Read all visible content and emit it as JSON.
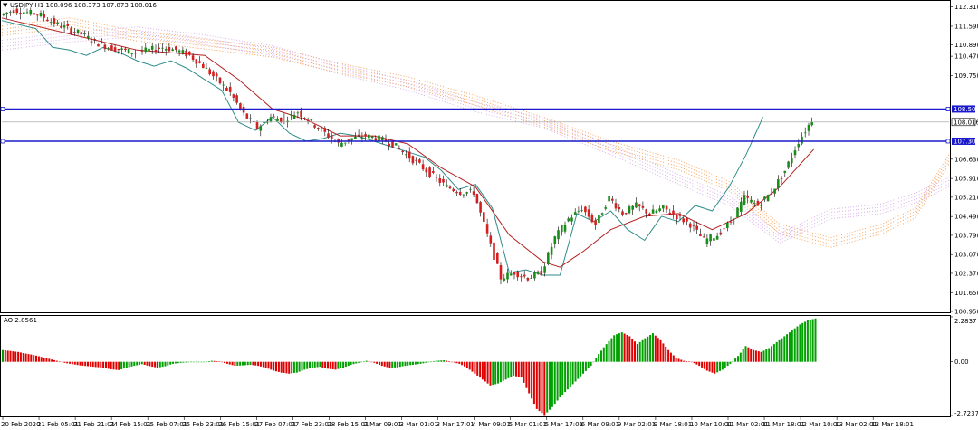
{
  "chart_data": [
    {
      "type": "candlestick",
      "title": "USDJPY,H1  108.096 108.373 107.873 108.016",
      "symbol": "USDJPY,H1",
      "ohlc_header": {
        "open": "108.096",
        "high": "108.373",
        "low": "107.873",
        "close": "108.016"
      },
      "y_ticks": [
        "112.310",
        "111.590",
        "110.890",
        "110.470",
        "109.750",
        "108.016",
        "106.630",
        "105.910",
        "105.210",
        "104.490",
        "103.790",
        "103.070",
        "102.370",
        "101.650",
        "100.950"
      ],
      "ylim": [
        100.95,
        112.5
      ],
      "horizontal_levels": [
        {
          "label": "108.500",
          "value": 108.5,
          "color": "#1a1acc"
        },
        {
          "label": "107.300",
          "value": 107.3,
          "color": "#1a1acc"
        }
      ],
      "current_price": {
        "label": "108.016",
        "value": 108.016
      },
      "x_labels": [
        "20 Feb 2020",
        "21 Feb 05:01",
        "21 Feb 21:01",
        "24 Feb 15:01",
        "25 Feb 07:01",
        "25 Feb 23:01",
        "26 Feb 15:01",
        "27 Feb 07:01",
        "27 Feb 23:01",
        "28 Feb 15:01",
        "2 Mar 09:01",
        "3 Mar 01:01",
        "3 Mar 17:01",
        "4 Mar 09:01",
        "5 Mar 01:01",
        "5 Mar 17:01",
        "6 Mar 09:01",
        "9 Mar 02:01",
        "9 Mar 18:01",
        "10 Mar 10:01",
        "11 Mar 02:01",
        "11 Mar 18:01",
        "12 Mar 10:01",
        "13 Mar 02:01",
        "13 Mar 18:01"
      ],
      "price_path": [
        [
          0,
          112.0
        ],
        [
          4,
          112.2
        ],
        [
          8,
          112.1
        ],
        [
          12,
          112.0
        ],
        [
          16,
          111.7
        ],
        [
          20,
          111.5
        ],
        [
          24,
          111.3
        ],
        [
          28,
          111.0
        ],
        [
          32,
          110.8
        ],
        [
          36,
          110.7
        ],
        [
          40,
          110.6
        ],
        [
          44,
          110.7
        ],
        [
          48,
          110.8
        ],
        [
          52,
          110.7
        ],
        [
          56,
          110.5
        ],
        [
          60,
          110.1
        ],
        [
          64,
          109.6
        ],
        [
          68,
          109.1
        ],
        [
          72,
          108.3
        ],
        [
          76,
          107.8
        ],
        [
          80,
          108.2
        ],
        [
          84,
          108.1
        ],
        [
          88,
          108.4
        ],
        [
          92,
          108.0
        ],
        [
          96,
          107.6
        ],
        [
          100,
          107.2
        ],
        [
          104,
          107.4
        ],
        [
          108,
          107.5
        ],
        [
          112,
          107.4
        ],
        [
          116,
          107.2
        ],
        [
          120,
          106.8
        ],
        [
          124,
          106.4
        ],
        [
          128,
          106.0
        ],
        [
          132,
          105.6
        ],
        [
          136,
          105.4
        ],
        [
          140,
          105.4
        ],
        [
          144,
          103.8
        ],
        [
          148,
          102.2
        ],
        [
          152,
          102.4
        ],
        [
          156,
          102.2
        ],
        [
          160,
          102.4
        ],
        [
          164,
          103.7
        ],
        [
          168,
          104.4
        ],
        [
          172,
          104.8
        ],
        [
          176,
          104.2
        ],
        [
          180,
          105.2
        ],
        [
          184,
          104.6
        ],
        [
          188,
          104.9
        ],
        [
          192,
          104.6
        ],
        [
          196,
          104.8
        ],
        [
          200,
          104.5
        ],
        [
          204,
          104.2
        ],
        [
          208,
          103.6
        ],
        [
          212,
          103.8
        ],
        [
          216,
          104.3
        ],
        [
          220,
          105.2
        ],
        [
          224,
          104.9
        ],
        [
          228,
          105.4
        ],
        [
          232,
          106.2
        ],
        [
          236,
          107.3
        ],
        [
          240,
          108.1
        ]
      ],
      "moving_average": [
        [
          0,
          111.9
        ],
        [
          20,
          111.3
        ],
        [
          40,
          110.7
        ],
        [
          60,
          110.5
        ],
        [
          70,
          109.6
        ],
        [
          80,
          108.5
        ],
        [
          90,
          108.1
        ],
        [
          100,
          107.5
        ],
        [
          110,
          107.5
        ],
        [
          120,
          107.2
        ],
        [
          130,
          106.3
        ],
        [
          140,
          105.6
        ],
        [
          150,
          103.8
        ],
        [
          160,
          102.8
        ],
        [
          165,
          102.6
        ],
        [
          172,
          103.2
        ],
        [
          180,
          104.0
        ],
        [
          190,
          104.5
        ],
        [
          200,
          104.6
        ],
        [
          210,
          104.0
        ],
        [
          220,
          104.6
        ],
        [
          230,
          105.6
        ],
        [
          240,
          107.0
        ]
      ],
      "chikou_span": [
        [
          0,
          111.8
        ],
        [
          10,
          111.5
        ],
        [
          15,
          110.8
        ],
        [
          20,
          110.7
        ],
        [
          25,
          110.5
        ],
        [
          30,
          110.8
        ],
        [
          35,
          110.6
        ],
        [
          40,
          110.3
        ],
        [
          45,
          110.1
        ],
        [
          50,
          110.3
        ],
        [
          55,
          110.0
        ],
        [
          60,
          109.6
        ],
        [
          65,
          109.2
        ],
        [
          70,
          108.0
        ],
        [
          75,
          107.7
        ],
        [
          80,
          108.2
        ],
        [
          85,
          107.6
        ],
        [
          90,
          107.3
        ],
        [
          95,
          107.4
        ],
        [
          100,
          107.6
        ],
        [
          105,
          107.5
        ],
        [
          110,
          107.3
        ],
        [
          115,
          107.1
        ],
        [
          120,
          106.9
        ],
        [
          125,
          106.7
        ],
        [
          130,
          106.2
        ],
        [
          135,
          105.5
        ],
        [
          140,
          105.7
        ],
        [
          145,
          104.8
        ],
        [
          150,
          102.4
        ],
        [
          155,
          102.5
        ],
        [
          160,
          102.3
        ],
        [
          165,
          102.3
        ],
        [
          170,
          104.6
        ],
        [
          175,
          104.3
        ],
        [
          180,
          104.7
        ],
        [
          185,
          104.0
        ],
        [
          190,
          103.6
        ],
        [
          195,
          104.5
        ],
        [
          200,
          104.3
        ],
        [
          205,
          104.9
        ],
        [
          210,
          104.7
        ],
        [
          215,
          105.6
        ],
        [
          220,
          106.8
        ],
        [
          225,
          108.2
        ]
      ],
      "ichimoku_cloud": {
        "span_a": [
          [
            0,
            111.6
          ],
          [
            20,
            111.9
          ],
          [
            40,
            111.4
          ],
          [
            60,
            111.1
          ],
          [
            80,
            110.8
          ],
          [
            100,
            110.2
          ],
          [
            120,
            109.7
          ],
          [
            140,
            109.0
          ],
          [
            160,
            108.2
          ],
          [
            180,
            107.3
          ],
          [
            200,
            106.6
          ],
          [
            215,
            105.8
          ],
          [
            230,
            104.2
          ],
          [
            245,
            103.7
          ],
          [
            260,
            104.2
          ],
          [
            270,
            104.8
          ],
          [
            280,
            106.8
          ]
        ],
        "span_b": [
          [
            0,
            110.7
          ],
          [
            20,
            111.0
          ],
          [
            40,
            111.2
          ],
          [
            60,
            110.9
          ],
          [
            80,
            110.5
          ],
          [
            100,
            109.8
          ],
          [
            120,
            109.2
          ],
          [
            140,
            108.4
          ],
          [
            160,
            107.8
          ],
          [
            180,
            106.8
          ],
          [
            200,
            105.7
          ],
          [
            215,
            104.9
          ],
          [
            230,
            103.5
          ],
          [
            245,
            104.4
          ],
          [
            260,
            104.6
          ],
          [
            270,
            105.0
          ],
          [
            280,
            105.6
          ]
        ]
      },
      "price_axis_label_color": "#000000"
    },
    {
      "type": "histogram",
      "title": "AO 2.8561",
      "indicator": "AO",
      "value_label": "2.8561",
      "y_ticks": [
        "2.2837",
        "0.00",
        "-2.7237"
      ],
      "ylim": [
        -2.7237,
        2.2837
      ],
      "values": [
        0.6,
        0.55,
        0.5,
        0.42,
        0.35,
        0.25,
        0.15,
        0.05,
        -0.05,
        -0.12,
        -0.18,
        -0.22,
        -0.26,
        -0.3,
        -0.38,
        -0.42,
        -0.3,
        -0.2,
        -0.12,
        -0.22,
        -0.3,
        -0.22,
        -0.1,
        -0.05,
        -0.02,
        -0.02,
        0.0,
        0.05,
        0.02,
        -0.1,
        -0.2,
        -0.18,
        -0.15,
        -0.2,
        -0.3,
        -0.45,
        -0.55,
        -0.6,
        -0.55,
        -0.4,
        -0.3,
        -0.25,
        -0.35,
        -0.4,
        -0.3,
        -0.15,
        -0.05,
        0.05,
        -0.05,
        -0.2,
        -0.3,
        -0.28,
        -0.2,
        -0.15,
        -0.1,
        -0.02,
        0.05,
        0.08,
        0.0,
        -0.1,
        -0.3,
        -0.6,
        -0.9,
        -1.2,
        -1.1,
        -0.9,
        -0.7,
        -0.8,
        -1.6,
        -2.4,
        -2.7,
        -2.3,
        -1.8,
        -1.4,
        -1.0,
        -0.6,
        -0.2,
        0.4,
        0.9,
        1.35,
        1.5,
        1.3,
        0.9,
        1.2,
        1.45,
        1.1,
        0.6,
        0.2,
        0.05,
        0.0,
        -0.2,
        -0.45,
        -0.6,
        -0.4,
        -0.1,
        0.3,
        0.8,
        0.6,
        0.5,
        0.7,
        1.0,
        1.3,
        1.6,
        1.9,
        2.1,
        2.2
      ],
      "up_color": "#00a000",
      "down_color": "#e00000"
    }
  ]
}
